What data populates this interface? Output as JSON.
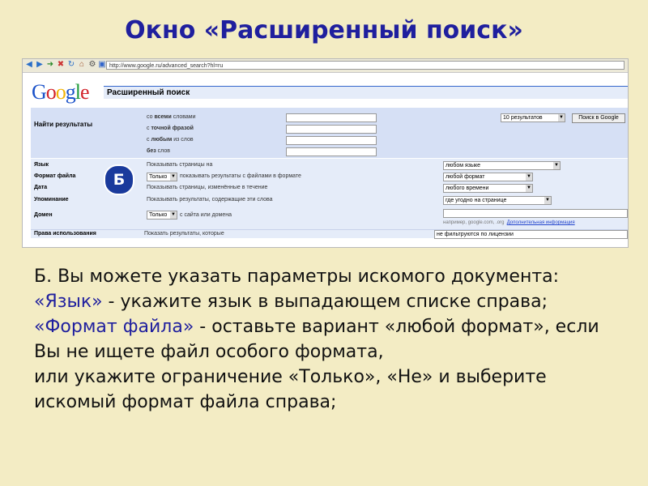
{
  "slide": {
    "title": "Окно «Расширенный поиск»"
  },
  "browser": {
    "url": "http://www.google.ru/advanced_search?hl=ru"
  },
  "google": {
    "logo": {
      "letters": [
        "G",
        "o",
        "o",
        "g",
        "l",
        "e"
      ],
      "colors": [
        "#1b52c9",
        "#d2232a",
        "#f2b40a",
        "#1b52c9",
        "#1f9b3a",
        "#d2232a"
      ]
    },
    "header_title": "Расширенный поиск",
    "find": {
      "label": "Найти результаты",
      "rows": [
        {
          "pre": "со",
          "bold": "всеми",
          "post": "словами"
        },
        {
          "pre": "с",
          "bold": "точной фразой",
          "post": ""
        },
        {
          "pre": "с",
          "bold": "любым",
          "post": "из слов"
        },
        {
          "pre": "",
          "bold": "без",
          "post": "слов"
        }
      ],
      "results_select": "10 результатов",
      "search_button": "Поиск в Google"
    },
    "options": {
      "language": {
        "label": "Язык",
        "text": "Показывать страницы на",
        "select": "любом языке"
      },
      "file_format": {
        "label": "Формат файла",
        "mode": "Только",
        "text": "показывать результаты с файлами в формате",
        "select": "любой формат"
      },
      "date": {
        "label": "Дата",
        "text": "Показывать страницы, изменённые в течение",
        "select": "любого времени"
      },
      "occurrence": {
        "label": "Упоминание",
        "text": "Показывать результаты, содержащие эти слова",
        "select": "где угодно на странице"
      },
      "domain": {
        "label": "Домен",
        "mode": "Только",
        "text": "с сайта или домена",
        "hint": "например, google.com, .org",
        "hint_link": "Дополнительная информация"
      },
      "rights": {
        "label": "Права использования",
        "text": "Показать результаты, которые",
        "select": "не фильтруются по лицензии"
      }
    },
    "badge": "Б"
  },
  "body": {
    "line1": "Б. Вы можете указать параметры искомого документа:",
    "lang_term": "«Язык»",
    "lang_rest": " - укажите язык в выпадающем списке справа;",
    "format_term": "«Формат файла»",
    "format_rest": " - оставьте вариант «любой формат», если Вы не ищете файл особого формата,",
    "last": "или укажите ограничение «Только», «Не» и выберите искомый формат файла справа;"
  }
}
